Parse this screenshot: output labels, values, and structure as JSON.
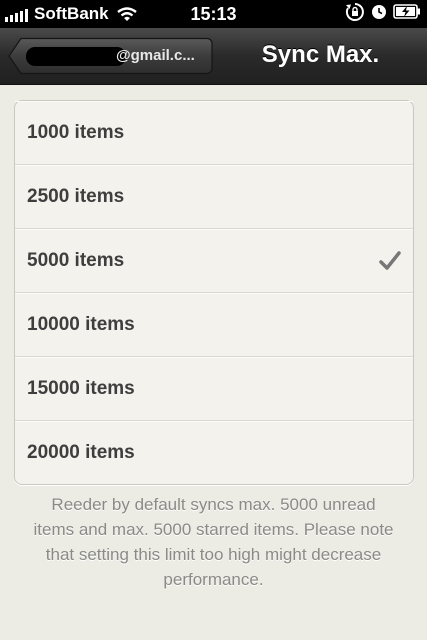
{
  "status_bar": {
    "carrier": "SoftBank",
    "time": "15:13"
  },
  "nav": {
    "back_label": "@gmail.c...",
    "title": "Sync Max."
  },
  "options": [
    {
      "label": "1000 items",
      "selected": false
    },
    {
      "label": "2500 items",
      "selected": false
    },
    {
      "label": "5000 items",
      "selected": true
    },
    {
      "label": "10000 items",
      "selected": false
    },
    {
      "label": "15000 items",
      "selected": false
    },
    {
      "label": "20000 items",
      "selected": false
    }
  ],
  "footer_note": "Reeder by default syncs max. 5000 unread items and max. 5000 starred items. Please note that setting this limit too high might decrease performance.",
  "colors": {
    "background": "#ecebe4",
    "nav_bar": "#2a2a2a",
    "list_text": "#3e3e3e",
    "note_text": "#8a8a86",
    "checkmark": "#777777"
  },
  "icons": [
    "signal-strength-icon",
    "wifi-icon",
    "rotation-lock-icon",
    "alarm-clock-icon",
    "battery-charging-icon",
    "checkmark-icon"
  ]
}
